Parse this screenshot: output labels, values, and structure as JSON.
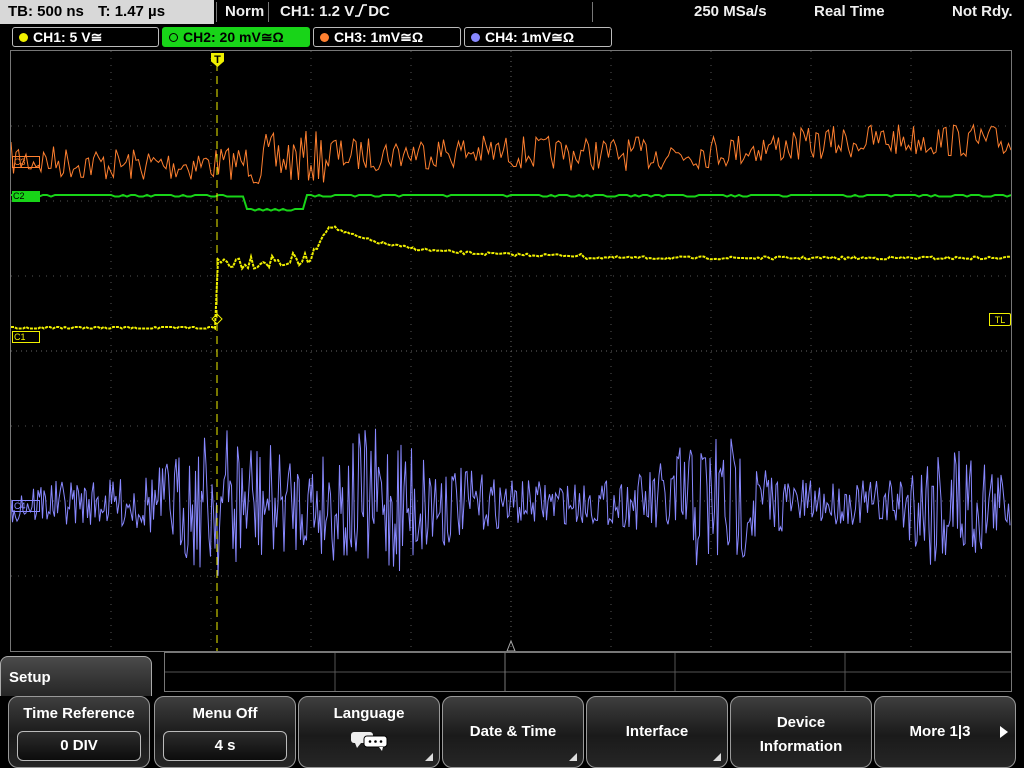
{
  "topbar": {
    "timebase": "TB: 500 ns",
    "trigger_time": "T: 1.47 µs",
    "trigger_mode": "Norm",
    "trigger_source": "CH1: 1.2 V",
    "trigger_coupling": "DC",
    "sample_rate": "250 MSa/s",
    "acq_mode": "Real Time",
    "status": "Not Rdy."
  },
  "channels": [
    {
      "label": "CH1: 5 V",
      "suffix": "≅",
      "color": "#f0f000"
    },
    {
      "label": "CH2: 20 mV",
      "suffix": "≅Ω",
      "color": "#18d418"
    },
    {
      "label": "CH3: 1mV",
      "suffix": "≅Ω",
      "color": "#ff8030"
    },
    {
      "label": "CH4: 1mV",
      "suffix": "≅Ω",
      "color": "#8888ff"
    }
  ],
  "markers": {
    "ch1": "C1",
    "ch2": "C2",
    "ch3": "C3",
    "ch4": "C4",
    "trigger_level": "TL",
    "trigger_pos": "T"
  },
  "menu": {
    "title": "Setup",
    "softkeys": [
      {
        "label": "Time Reference",
        "value": "0 DIV"
      },
      {
        "label": "Menu Off",
        "value": "4 s"
      },
      {
        "label": "Language"
      },
      {
        "label": "Date & Time"
      },
      {
        "label": "Interface"
      },
      {
        "label_line1": "Device",
        "label_line2": "Information"
      },
      {
        "label": "More 1|3"
      }
    ]
  }
}
